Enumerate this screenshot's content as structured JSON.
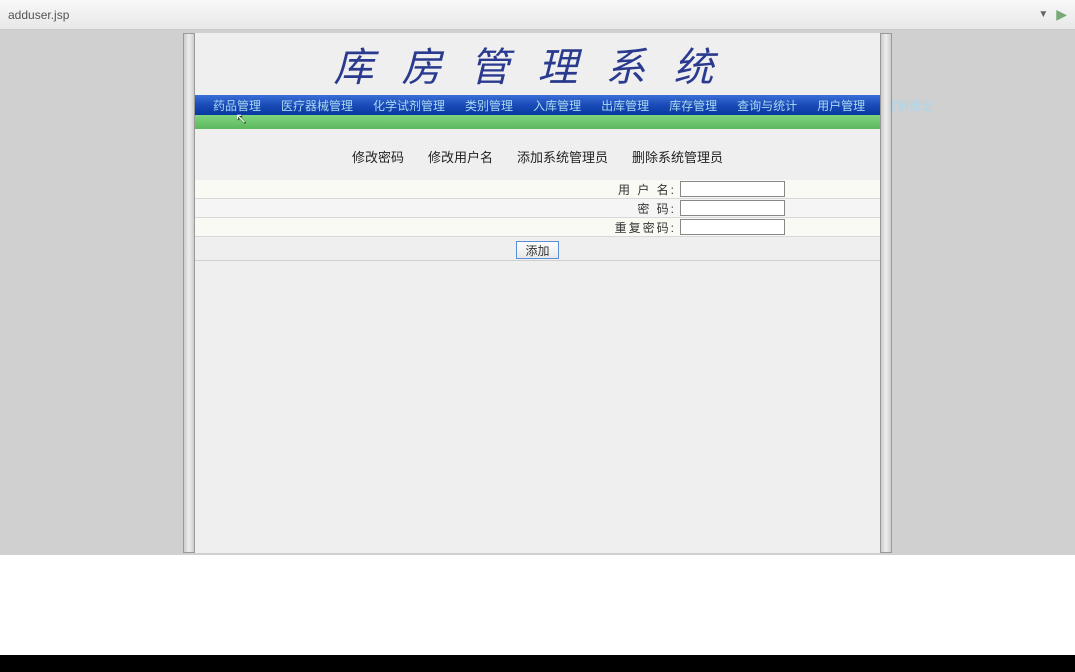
{
  "browser": {
    "url": "adduser.jsp"
  },
  "title": "库房管理系统",
  "nav": [
    "药品管理",
    "医疗器械管理",
    "化学试剂管理",
    "类别管理",
    "入库管理",
    "出库管理",
    "库存管理",
    "查询与统计",
    "用户管理",
    "注销退出"
  ],
  "subnav": [
    "修改密码",
    "修改用户名",
    "添加系统管理员",
    "删除系统管理员"
  ],
  "form": {
    "username_label": "用 户 名:",
    "username_value": "",
    "password_label": "密    码:",
    "password_value": "",
    "repeat_label": "重复密码:",
    "repeat_value": "",
    "submit_label": "添加"
  }
}
